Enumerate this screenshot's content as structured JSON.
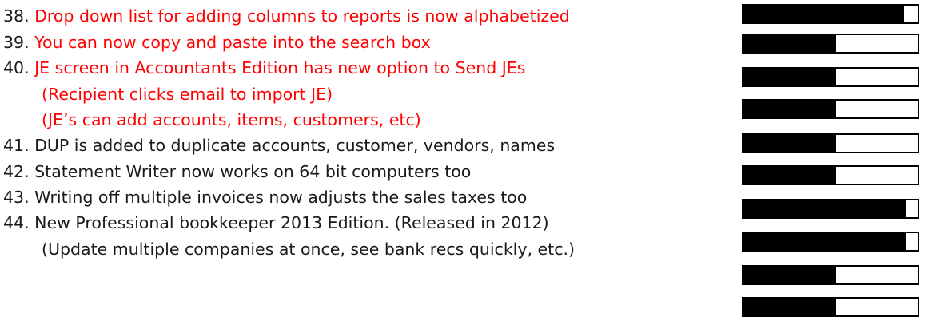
{
  "colors": {
    "highlight": "#ff0000",
    "normal": "#1a1a1a"
  },
  "items": [
    {
      "number": "38.",
      "text": "Drop down list for adding columns to reports is now alphabetized",
      "color": "#ff0000"
    },
    {
      "number": "39.",
      "text": "You can now copy and paste into the search box",
      "color": "#ff0000"
    },
    {
      "number": "40.",
      "text": "JE screen in Accountants Edition has new option to Send JEs",
      "color": "#ff0000"
    },
    {
      "number": "",
      "text": "(Recipient clicks email to import JE)",
      "color": "#ff0000"
    },
    {
      "number": "",
      "text": "(JE’s can add accounts, items, customers, etc)",
      "color": "#ff0000"
    },
    {
      "number": "41.",
      "text": "DUP is added to duplicate accounts, customer, vendors, names",
      "color": "#1a1a1a"
    },
    {
      "number": "42.",
      "text": "Statement Writer now works on 64 bit computers too",
      "color": "#1a1a1a"
    },
    {
      "number": "43.",
      "text": "Writing off multiple invoices now adjusts the sales taxes too",
      "color": "#1a1a1a"
    },
    {
      "number": "44.",
      "text": "New Professional bookkeeper 2013 Edition. (Released in 2012)",
      "color": "#1a1a1a"
    },
    {
      "number": "",
      "text": "(Update multiple companies at once, see bank recs quickly, etc.)",
      "color": "#1a1a1a"
    }
  ],
  "bars": [
    {
      "fill_fraction": 0.92
    },
    {
      "fill_fraction": 0.53
    },
    {
      "fill_fraction": 0.53
    },
    {
      "fill_fraction": 0.53
    },
    {
      "fill_fraction": 0.53
    },
    {
      "fill_fraction": 0.53
    },
    {
      "fill_fraction": 0.93
    },
    {
      "fill_fraction": 0.93
    },
    {
      "fill_fraction": 0.53
    },
    {
      "fill_fraction": 0.53
    }
  ]
}
